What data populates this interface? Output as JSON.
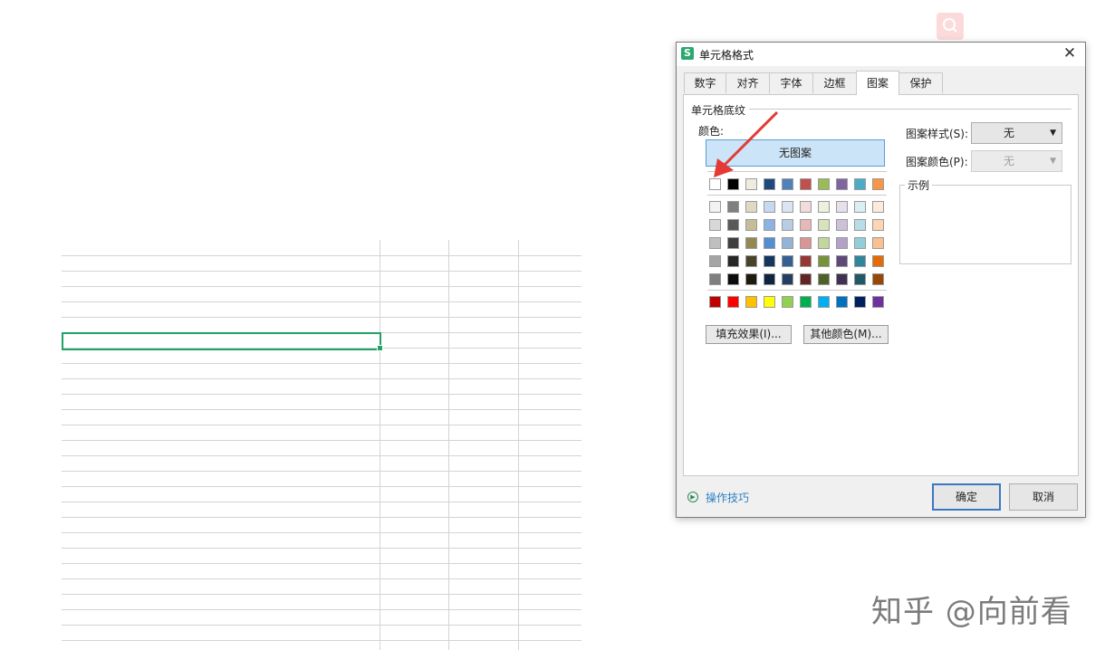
{
  "dialog": {
    "title": "单元格格式",
    "tabs": [
      "数字",
      "对齐",
      "字体",
      "边框",
      "图案",
      "保护"
    ],
    "active_tab": "图案",
    "group_label": "单元格底纹",
    "color_label": "颜色:",
    "no_pattern_label": "无图案",
    "palette": {
      "theme_top": [
        "#ffffff",
        "#000000",
        "#eeece1",
        "#1f497d",
        "#4f81bd",
        "#c0504d",
        "#9bbb59",
        "#8064a2",
        "#4bacc6",
        "#f79646"
      ],
      "tints": [
        [
          "#f2f2f2",
          "#7f7f7f",
          "#ddd9c3",
          "#c6d9f0",
          "#dbe5f1",
          "#f2dcdb",
          "#ebf1dd",
          "#e5e0ec",
          "#dbeef3",
          "#fdeada"
        ],
        [
          "#d8d8d8",
          "#595959",
          "#c4bd97",
          "#8db3e2",
          "#b8cce4",
          "#e5b9b7",
          "#d7e3bc",
          "#ccc1d9",
          "#b7dde8",
          "#fbd5b5"
        ],
        [
          "#bfbfbf",
          "#3f3f3f",
          "#938953",
          "#548dd4",
          "#95b3d7",
          "#d99694",
          "#c3d69b",
          "#b2a2c7",
          "#92cddc",
          "#fac08f"
        ],
        [
          "#a5a5a5",
          "#262626",
          "#494429",
          "#17365d",
          "#366092",
          "#953734",
          "#76923c",
          "#5f497a",
          "#31859b",
          "#e36c09"
        ],
        [
          "#7f7f7f",
          "#0c0c0c",
          "#1d1b10",
          "#0f243e",
          "#244061",
          "#632423",
          "#4f6128",
          "#3f3151",
          "#205867",
          "#974806"
        ]
      ],
      "standard": [
        "#c00000",
        "#ff0000",
        "#ffc000",
        "#ffff00",
        "#92d050",
        "#00b050",
        "#00b0f0",
        "#0070c0",
        "#002060",
        "#7030a0"
      ]
    },
    "fill_effects_button": "填充效果(I)...",
    "more_colors_button": "其他颜色(M)...",
    "pattern_style_label": "图案样式(S):",
    "pattern_style_value": "无",
    "pattern_color_label": "图案颜色(P):",
    "pattern_color_value": "无",
    "sample_label": "示例",
    "tips_link": "操作技巧",
    "ok_button": "确定",
    "cancel_button": "取消"
  },
  "watermark": "知乎 @向前看",
  "colors": {
    "selection": "#21a366",
    "accent": "#3a78c3",
    "annotation_arrow": "#e53935"
  }
}
